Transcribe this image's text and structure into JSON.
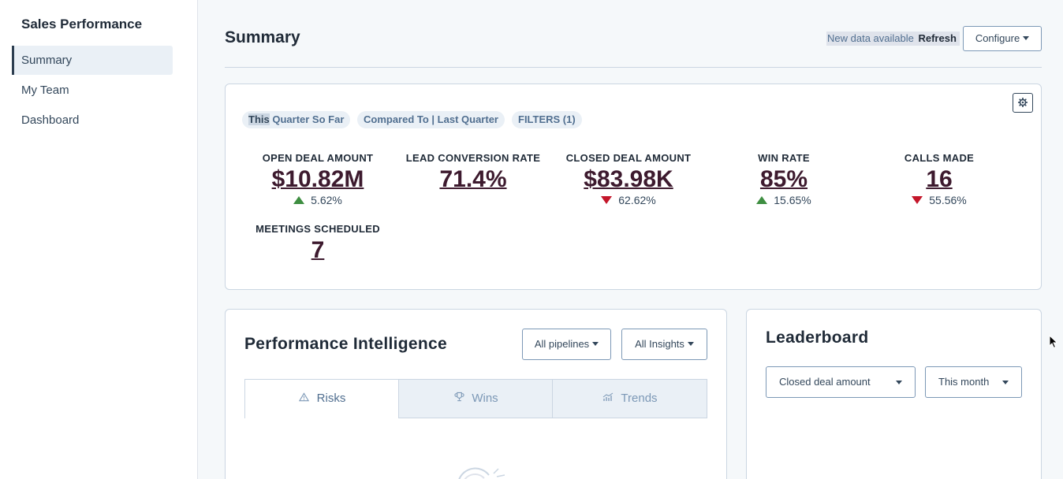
{
  "sidebar": {
    "title": "Sales Performance",
    "items": [
      {
        "label": "Summary",
        "active": true
      },
      {
        "label": "My Team",
        "active": false
      },
      {
        "label": "Dashboard",
        "active": false
      }
    ]
  },
  "header": {
    "title": "Summary",
    "new_data_text": "New data available",
    "refresh_label": "Refresh",
    "configure_label": "Configure"
  },
  "summary_card": {
    "settings_icon": "gear-icon",
    "chips": {
      "period_highlight": "This",
      "period_rest": " Quarter So Far",
      "compare": "Compared To | Last Quarter",
      "filters": "FILTERS (1)"
    },
    "metrics": [
      {
        "label": "OPEN DEAL AMOUNT",
        "value": "$10.82M",
        "change": "5.62%",
        "direction": "up"
      },
      {
        "label": "LEAD CONVERSION RATE",
        "value": "71.4%",
        "change": "",
        "direction": "none"
      },
      {
        "label": "CLOSED DEAL AMOUNT",
        "value": "$83.98K",
        "change": "62.62%",
        "direction": "down"
      },
      {
        "label": "WIN RATE",
        "value": "85%",
        "change": "15.65%",
        "direction": "up"
      },
      {
        "label": "CALLS MADE",
        "value": "16",
        "change": "55.56%",
        "direction": "down"
      },
      {
        "label": "MEETINGS SCHEDULED",
        "value": "7",
        "change": "",
        "direction": "none"
      }
    ],
    "colors": {
      "up": "#3e8e41",
      "down": "#c4162a",
      "value": "#3d1a2e"
    }
  },
  "performance": {
    "title": "Performance Intelligence",
    "pipelines_label": "All pipelines",
    "insights_label": "All Insights",
    "tabs": [
      {
        "label": "Risks",
        "icon": "warning-icon",
        "active": true
      },
      {
        "label": "Wins",
        "icon": "trophy-icon",
        "active": false
      },
      {
        "label": "Trends",
        "icon": "trend-icon",
        "active": false
      }
    ]
  },
  "leaderboard": {
    "title": "Leaderboard",
    "metric_select": "Closed deal amount",
    "period_select": "This month"
  }
}
